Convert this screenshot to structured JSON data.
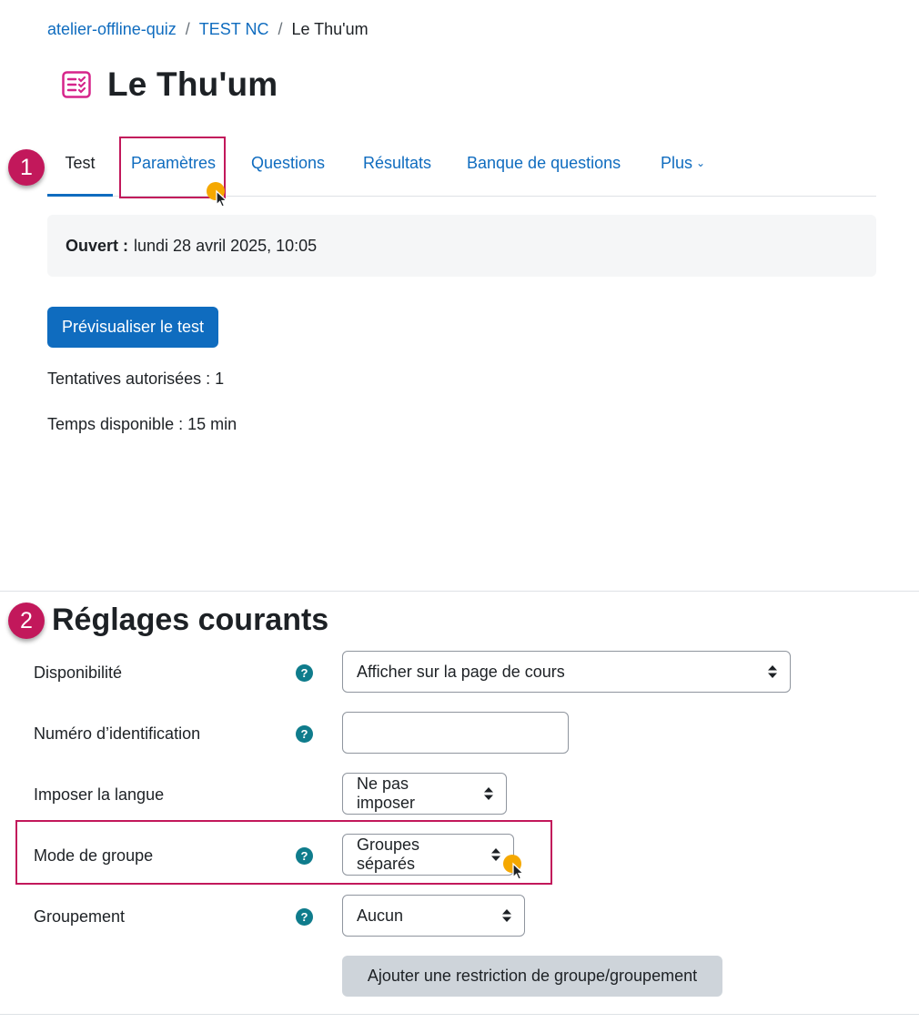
{
  "breadcrumb": {
    "items": [
      "atelier-offline-quiz",
      "TEST NC"
    ],
    "current": "Le Thu'um",
    "separator": "/"
  },
  "page_title": "Le Thu'um",
  "badges": [
    "1",
    "2"
  ],
  "tabs": [
    {
      "label": "Test",
      "active": true
    },
    {
      "label": "Paramètres",
      "active": false
    },
    {
      "label": "Questions",
      "active": false
    },
    {
      "label": "Résultats",
      "active": false
    },
    {
      "label": "Banque de questions",
      "active": false
    },
    {
      "label": "Plus",
      "active": false
    }
  ],
  "open_info": {
    "label": "Ouvert :",
    "value": "lundi 28 avril 2025, 10:05"
  },
  "preview_button": "Prévisualiser le test",
  "attempts_text": "Tentatives autorisées : 1",
  "time_text": "Temps disponible : 15 min",
  "section_title": "Réglages courants",
  "help_symbol": "?",
  "form": {
    "availability": {
      "label": "Disponibilité",
      "value": "Afficher sur la page de cours"
    },
    "idnumber": {
      "label": "Numéro d’identification",
      "value": ""
    },
    "language": {
      "label": "Imposer la langue",
      "value": "Ne pas imposer"
    },
    "groupmode": {
      "label": "Mode de groupe",
      "value": "Groupes séparés"
    },
    "grouping": {
      "label": "Groupement",
      "value": "Aucun"
    },
    "restriction_button": "Ajouter une restriction de groupe/groupement"
  },
  "colors": {
    "link": "#0f6cbf",
    "highlight": "#c2185b",
    "help": "#0f7c8c",
    "cursor_dot": "#f5a800"
  }
}
